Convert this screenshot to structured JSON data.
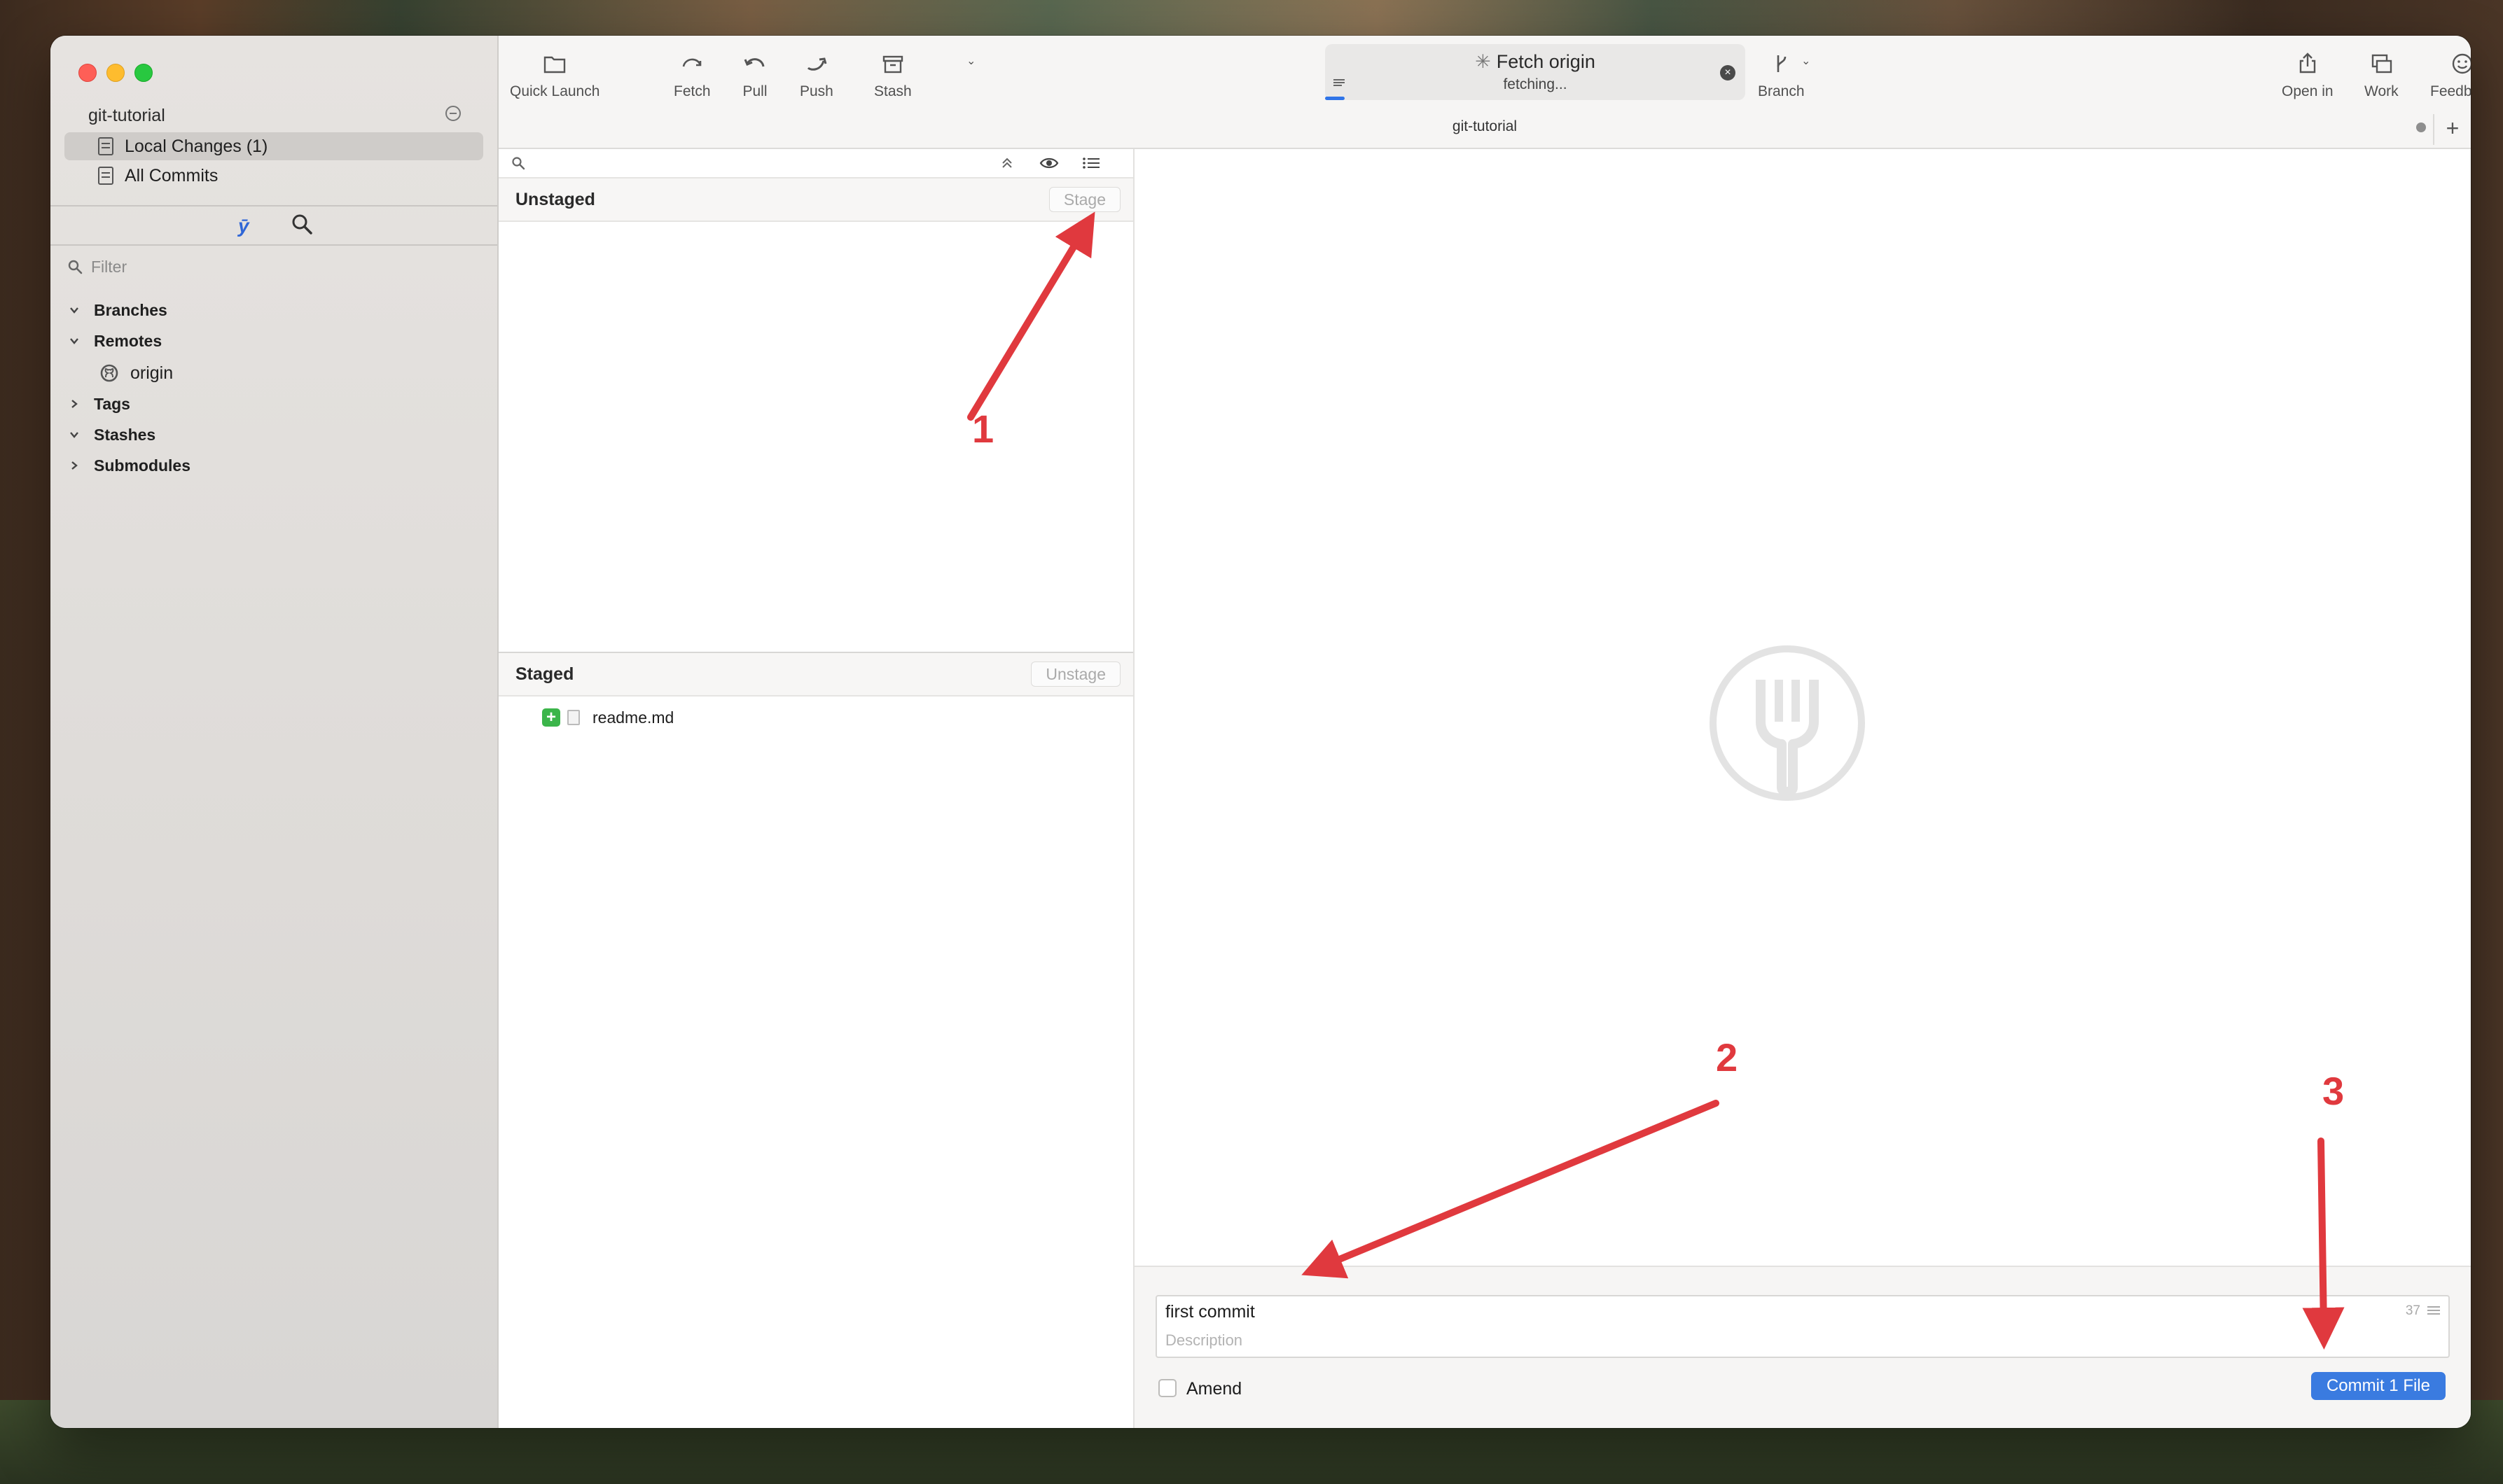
{
  "sidebar": {
    "repo_name": "git-tutorial",
    "nav": [
      {
        "label": "Local Changes (1)",
        "selected": true
      },
      {
        "label": "All Commits",
        "selected": false
      }
    ],
    "filter_placeholder": "Filter",
    "tree": [
      {
        "label": "Branches",
        "expanded": true
      },
      {
        "label": "Remotes",
        "expanded": true
      },
      {
        "label": "Tags",
        "expanded": false
      },
      {
        "label": "Stashes",
        "expanded": true
      },
      {
        "label": "Submodules",
        "expanded": false
      }
    ],
    "remote_origin": "origin"
  },
  "toolbar": {
    "quick_launch": "Quick Launch",
    "fetch": "Fetch",
    "pull": "Pull",
    "push": "Push",
    "stash": "Stash",
    "branch": "Branch",
    "open_in": "Open in",
    "work": "Work",
    "feedback": "Feedback"
  },
  "activity": {
    "title": "Fetch origin",
    "status": "fetching..."
  },
  "path_title": "git-tutorial",
  "filelist": {
    "unstaged_label": "Unstaged",
    "stage_button": "Stage",
    "staged_label": "Staged",
    "unstage_button": "Unstage",
    "staged_files": [
      {
        "name": "readme.md",
        "status": "added"
      }
    ]
  },
  "commit": {
    "subject": "first commit",
    "char_count": "37",
    "description_placeholder": "Description",
    "amend_label": "Amend",
    "amend_checked": false,
    "commit_button": "Commit 1 File"
  },
  "annotations": [
    "1",
    "2",
    "3"
  ],
  "colors": {
    "accent": "#3a7be0",
    "annotation": "#e0393e",
    "added": "#3bb54a"
  }
}
